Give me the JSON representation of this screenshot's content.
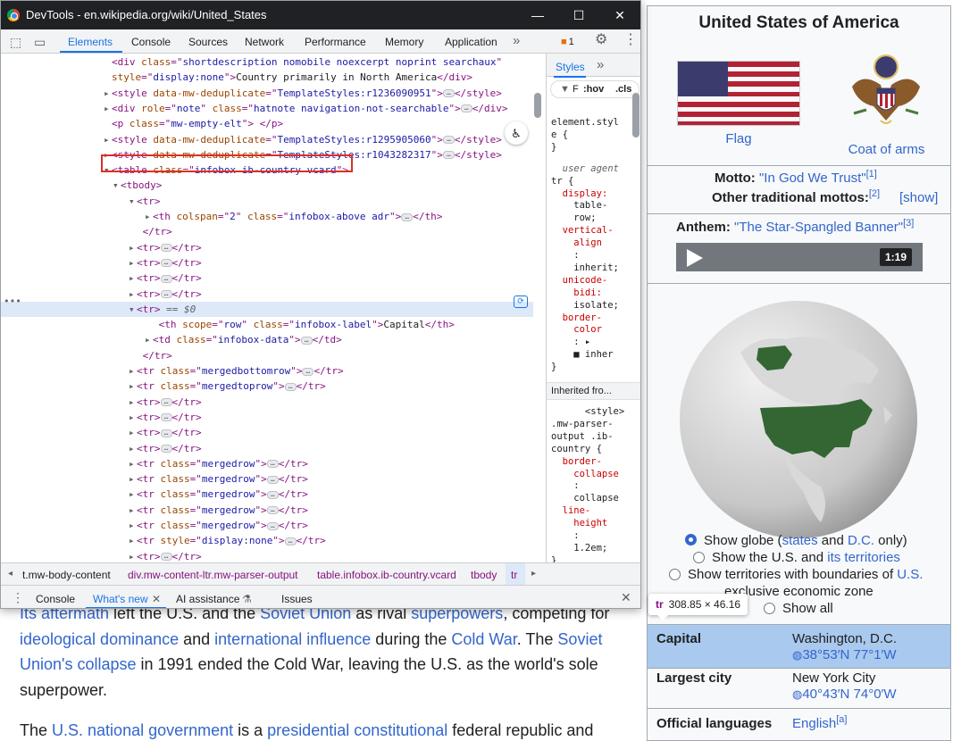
{
  "window": {
    "title": "DevTools - en.wikipedia.org/wiki/United_States",
    "minimize": "—",
    "maximize": "☐",
    "close": "✕"
  },
  "devtools_tabs": [
    "Elements",
    "Console",
    "Sources",
    "Network",
    "Performance",
    "Memory",
    "Application"
  ],
  "more_tabs": "»",
  "issues_count": "1",
  "dom_lines": [
    {
      "indent": 0,
      "tri": "",
      "parts": [
        [
          "t",
          "<div "
        ],
        [
          "n",
          "class"
        ],
        [
          "t",
          "=\""
        ],
        [
          "v",
          "shortdescription nomobile noexcerpt noprint searchaux"
        ],
        [
          "t",
          "\""
        ]
      ]
    },
    {
      "indent": 0,
      "tri": "",
      "parts": [
        [
          "n",
          "style"
        ],
        [
          "t",
          "=\""
        ],
        [
          "v",
          "display:none"
        ],
        [
          "t",
          "\">"
        ],
        [
          "x",
          "Country primarily in North America"
        ],
        [
          "t",
          "</div>"
        ]
      ]
    },
    {
      "indent": 0,
      "tri": "▸",
      "parts": [
        [
          "t",
          "<style "
        ],
        [
          "n",
          "data-mw-deduplicate"
        ],
        [
          "t",
          "=\""
        ],
        [
          "v",
          "TemplateStyles:r1236090951"
        ],
        [
          "t",
          "\">"
        ],
        [
          "p",
          "…"
        ],
        [
          "t",
          "</style>"
        ]
      ]
    },
    {
      "indent": 0,
      "tri": "▸",
      "parts": [
        [
          "t",
          "<div "
        ],
        [
          "n",
          "role"
        ],
        [
          "t",
          "=\""
        ],
        [
          "v",
          "note"
        ],
        [
          "t",
          "\" "
        ],
        [
          "n",
          "class"
        ],
        [
          "t",
          "=\""
        ],
        [
          "v",
          "hatnote navigation-not-searchable"
        ],
        [
          "t",
          "\">"
        ],
        [
          "p",
          "…"
        ],
        [
          "t",
          "</div>"
        ]
      ]
    },
    {
      "indent": 0,
      "tri": "",
      "parts": [
        [
          "t",
          "<p "
        ],
        [
          "n",
          "class"
        ],
        [
          "t",
          "=\""
        ],
        [
          "v",
          "mw-empty-elt"
        ],
        [
          "t",
          "\"> </p>"
        ]
      ]
    },
    {
      "indent": 0,
      "tri": "▸",
      "parts": [
        [
          "t",
          "<style "
        ],
        [
          "n",
          "data-mw-deduplicate"
        ],
        [
          "t",
          "=\""
        ],
        [
          "v",
          "TemplateStyles:r1295905060"
        ],
        [
          "t",
          "\">"
        ],
        [
          "p",
          "…"
        ],
        [
          "t",
          "</style>"
        ]
      ]
    },
    {
      "indent": 0,
      "tri": "▸",
      "parts": [
        [
          "t",
          "<style "
        ],
        [
          "n",
          "data-mw-deduplicate"
        ],
        [
          "t",
          "=\""
        ],
        [
          "v",
          "TemplateStyles:r1043282317"
        ],
        [
          "t",
          "\">"
        ],
        [
          "p",
          "…"
        ],
        [
          "t",
          "</style>"
        ]
      ]
    },
    {
      "indent": 0,
      "tri": "▾",
      "parts": [
        [
          "t",
          "<table "
        ],
        [
          "n",
          "class"
        ],
        [
          "t",
          "=\""
        ],
        [
          "v",
          "infobox ib-country vcard"
        ],
        [
          "t",
          "\">"
        ]
      ]
    },
    {
      "indent": 1,
      "tri": "▾",
      "parts": [
        [
          "t",
          "<tbody>"
        ]
      ]
    },
    {
      "indent": 2,
      "tri": "▾",
      "parts": [
        [
          "t",
          "<tr>"
        ]
      ]
    },
    {
      "indent": 3,
      "tri": "▸",
      "parts": [
        [
          "t",
          "<th "
        ],
        [
          "n",
          "colspan"
        ],
        [
          "t",
          "=\""
        ],
        [
          "v",
          "2"
        ],
        [
          "t",
          "\" "
        ],
        [
          "n",
          "class"
        ],
        [
          "t",
          "=\""
        ],
        [
          "v",
          "infobox-above adr"
        ],
        [
          "t",
          "\">"
        ],
        [
          "p",
          "…"
        ],
        [
          "t",
          "</th>"
        ]
      ]
    },
    {
      "indent": 2,
      "tri": "",
      "parts": [
        [
          "t",
          " </tr>"
        ]
      ]
    },
    {
      "indent": 2,
      "tri": "▸",
      "parts": [
        [
          "t",
          "<tr>"
        ],
        [
          "p",
          "…"
        ],
        [
          "t",
          "</tr>"
        ]
      ]
    },
    {
      "indent": 2,
      "tri": "▸",
      "parts": [
        [
          "t",
          "<tr>"
        ],
        [
          "p",
          "…"
        ],
        [
          "t",
          "</tr>"
        ]
      ]
    },
    {
      "indent": 2,
      "tri": "▸",
      "parts": [
        [
          "t",
          "<tr>"
        ],
        [
          "p",
          "…"
        ],
        [
          "t",
          "</tr>"
        ]
      ]
    },
    {
      "indent": 2,
      "tri": "▸",
      "parts": [
        [
          "t",
          "<tr>"
        ],
        [
          "p",
          "…"
        ],
        [
          "t",
          "</tr>"
        ]
      ]
    },
    {
      "indent": 2,
      "tri": "▾",
      "parts": [
        [
          "t",
          "<tr>"
        ],
        [
          "e",
          " == $0"
        ]
      ],
      "selected": true
    },
    {
      "indent": 3,
      "tri": "",
      "parts": [
        [
          "t",
          " <th "
        ],
        [
          "n",
          "scope"
        ],
        [
          "t",
          "=\""
        ],
        [
          "v",
          "row"
        ],
        [
          "t",
          "\" "
        ],
        [
          "n",
          "class"
        ],
        [
          "t",
          "=\""
        ],
        [
          "v",
          "infobox-label"
        ],
        [
          "t",
          "\">"
        ],
        [
          "x",
          "Capital"
        ],
        [
          "t",
          "</th>"
        ]
      ]
    },
    {
      "indent": 3,
      "tri": "▸",
      "parts": [
        [
          "t",
          "<td "
        ],
        [
          "n",
          "class"
        ],
        [
          "t",
          "=\""
        ],
        [
          "v",
          "infobox-data"
        ],
        [
          "t",
          "\">"
        ],
        [
          "p",
          "…"
        ],
        [
          "t",
          "</td>"
        ]
      ]
    },
    {
      "indent": 2,
      "tri": "",
      "parts": [
        [
          "t",
          " </tr>"
        ]
      ]
    },
    {
      "indent": 2,
      "tri": "▸",
      "parts": [
        [
          "t",
          "<tr "
        ],
        [
          "n",
          "class"
        ],
        [
          "t",
          "=\""
        ],
        [
          "v",
          "mergedbottomrow"
        ],
        [
          "t",
          "\">"
        ],
        [
          "p",
          "…"
        ],
        [
          "t",
          "</tr>"
        ]
      ]
    },
    {
      "indent": 2,
      "tri": "▸",
      "parts": [
        [
          "t",
          "<tr "
        ],
        [
          "n",
          "class"
        ],
        [
          "t",
          "=\""
        ],
        [
          "v",
          "mergedtoprow"
        ],
        [
          "t",
          "\">"
        ],
        [
          "p",
          "…"
        ],
        [
          "t",
          "</tr>"
        ]
      ]
    },
    {
      "indent": 2,
      "tri": "▸",
      "parts": [
        [
          "t",
          "<tr>"
        ],
        [
          "p",
          "…"
        ],
        [
          "t",
          "</tr>"
        ]
      ]
    },
    {
      "indent": 2,
      "tri": "▸",
      "parts": [
        [
          "t",
          "<tr>"
        ],
        [
          "p",
          "…"
        ],
        [
          "t",
          "</tr>"
        ]
      ]
    },
    {
      "indent": 2,
      "tri": "▸",
      "parts": [
        [
          "t",
          "<tr>"
        ],
        [
          "p",
          "…"
        ],
        [
          "t",
          "</tr>"
        ]
      ]
    },
    {
      "indent": 2,
      "tri": "▸",
      "parts": [
        [
          "t",
          "<tr>"
        ],
        [
          "p",
          "…"
        ],
        [
          "t",
          "</tr>"
        ]
      ]
    },
    {
      "indent": 2,
      "tri": "▸",
      "parts": [
        [
          "t",
          "<tr "
        ],
        [
          "n",
          "class"
        ],
        [
          "t",
          "=\""
        ],
        [
          "v",
          "mergedrow"
        ],
        [
          "t",
          "\">"
        ],
        [
          "p",
          "…"
        ],
        [
          "t",
          "</tr>"
        ]
      ]
    },
    {
      "indent": 2,
      "tri": "▸",
      "parts": [
        [
          "t",
          "<tr "
        ],
        [
          "n",
          "class"
        ],
        [
          "t",
          "=\""
        ],
        [
          "v",
          "mergedrow"
        ],
        [
          "t",
          "\">"
        ],
        [
          "p",
          "…"
        ],
        [
          "t",
          "</tr>"
        ]
      ]
    },
    {
      "indent": 2,
      "tri": "▸",
      "parts": [
        [
          "t",
          "<tr "
        ],
        [
          "n",
          "class"
        ],
        [
          "t",
          "=\""
        ],
        [
          "v",
          "mergedrow"
        ],
        [
          "t",
          "\">"
        ],
        [
          "p",
          "…"
        ],
        [
          "t",
          "</tr>"
        ]
      ]
    },
    {
      "indent": 2,
      "tri": "▸",
      "parts": [
        [
          "t",
          "<tr "
        ],
        [
          "n",
          "class"
        ],
        [
          "t",
          "=\""
        ],
        [
          "v",
          "mergedrow"
        ],
        [
          "t",
          "\">"
        ],
        [
          "p",
          "…"
        ],
        [
          "t",
          "</tr>"
        ]
      ]
    },
    {
      "indent": 2,
      "tri": "▸",
      "parts": [
        [
          "t",
          "<tr "
        ],
        [
          "n",
          "class"
        ],
        [
          "t",
          "=\""
        ],
        [
          "v",
          "mergedrow"
        ],
        [
          "t",
          "\">"
        ],
        [
          "p",
          "…"
        ],
        [
          "t",
          "</tr>"
        ]
      ]
    },
    {
      "indent": 2,
      "tri": "▸",
      "parts": [
        [
          "t",
          "<tr "
        ],
        [
          "n",
          "style"
        ],
        [
          "t",
          "=\""
        ],
        [
          "v",
          "display:none"
        ],
        [
          "t",
          "\">"
        ],
        [
          "p",
          "…"
        ],
        [
          "t",
          "</tr>"
        ]
      ]
    },
    {
      "indent": 2,
      "tri": "▸",
      "parts": [
        [
          "t",
          "<tr>"
        ],
        [
          "p",
          "…"
        ],
        [
          "t",
          "</tr>"
        ]
      ]
    }
  ],
  "styles_panel": {
    "tab": "Styles",
    "filter_icon": "funnel-icon",
    "filter_text": "F",
    "hov": ":hov",
    "cls": ".cls",
    "lines": [
      {
        "t": "n",
        "s": "element.styl"
      },
      {
        "t": "n",
        "s": "e {"
      },
      {
        "t": "n",
        "s": "}"
      },
      {
        "t": "gap",
        "s": ""
      },
      {
        "t": "ua",
        "s": "  user agent"
      },
      {
        "t": "n",
        "s": "tr {"
      },
      {
        "t": "p",
        "s": "  display:"
      },
      {
        "t": "n",
        "s": "    table-"
      },
      {
        "t": "n",
        "s": "    row;"
      },
      {
        "t": "p",
        "s": "  vertical-"
      },
      {
        "t": "p",
        "s": "    align"
      },
      {
        "t": "n",
        "s": "    :"
      },
      {
        "t": "n",
        "s": "    inherit;"
      },
      {
        "t": "p",
        "s": "  unicode-"
      },
      {
        "t": "p",
        "s": "    bidi:"
      },
      {
        "t": "n",
        "s": "    isolate;"
      },
      {
        "t": "p",
        "s": "  border-"
      },
      {
        "t": "p",
        "s": "    color"
      },
      {
        "t": "n",
        "s": "    : ▸"
      },
      {
        "t": "n",
        "s": "    ■ inher"
      },
      {
        "t": "n",
        "s": "}"
      }
    ],
    "inherited_label": "Inherited fro...",
    "lines2": [
      {
        "t": "n",
        "s": "      <style>"
      },
      {
        "t": "n",
        "s": ".mw-parser-"
      },
      {
        "t": "n",
        "s": "output .ib-"
      },
      {
        "t": "n",
        "s": "country {"
      },
      {
        "t": "p",
        "s": "  border-"
      },
      {
        "t": "p",
        "s": "    collapse"
      },
      {
        "t": "n",
        "s": "    :"
      },
      {
        "t": "n",
        "s": "    collapse"
      },
      {
        "t": "p",
        "s": "  line-"
      },
      {
        "t": "p",
        "s": "    height"
      },
      {
        "t": "n",
        "s": "    :"
      },
      {
        "t": "n",
        "s": "    1.2em;"
      },
      {
        "t": "n",
        "s": "}"
      },
      {
        "t": "gap",
        "s": ""
      },
      {
        "t": "n",
        "s": "   load.php?"
      }
    ]
  },
  "breadcrumbs": [
    "t.mw-body-content",
    "div.mw-content-ltr.mw-parser-output",
    "table.infobox.ib-country.vcard",
    "tbody",
    "tr"
  ],
  "drawer": {
    "tabs": [
      "Console",
      "What's new",
      "AI assistance",
      "Issues"
    ],
    "close": "✕"
  },
  "wiki_paragraph1": [
    [
      [
        "a",
        "Its aftermath"
      ],
      [
        "t",
        " left the U.S. and the "
      ],
      [
        "a",
        "Soviet Union"
      ],
      [
        "t",
        " as rival "
      ],
      [
        "a",
        "superpowers"
      ],
      [
        "t",
        ", competing for"
      ]
    ],
    [
      [
        "a",
        "ideological dominance"
      ],
      [
        "t",
        " and "
      ],
      [
        "a",
        "international influence"
      ],
      [
        "t",
        " during the "
      ],
      [
        "a",
        "Cold War"
      ],
      [
        "t",
        ". The "
      ],
      [
        "a",
        "Soviet"
      ]
    ],
    [
      [
        "a",
        "Union's collapse"
      ],
      [
        "t",
        " in 1991 ended the Cold War, leaving the U.S. as the world's sole"
      ]
    ],
    [
      [
        "t",
        "superpower."
      ]
    ]
  ],
  "wiki_paragraph2": [
    [
      [
        "t",
        "The "
      ],
      [
        "a",
        "U.S. national government"
      ],
      [
        "t",
        " is a "
      ],
      [
        "a",
        "presidential constitutional"
      ],
      [
        "t",
        " federal republic and"
      ]
    ]
  ],
  "infobox": {
    "title": "United States of America",
    "flag_caption": "Flag",
    "coat_caption": "Coat of arms",
    "motto_label": "Motto: ",
    "motto_value": "\"In God We Trust\"",
    "motto_ref": "[1]",
    "other_mottos_label": "Other traditional mottos:",
    "other_mottos_ref": "[2]",
    "show_link": "[show]",
    "anthem_label": "Anthem: ",
    "anthem_value": "\"The Star-Spangled Banner\"",
    "anthem_ref": "[3]",
    "player_time": "1:19",
    "radio1_a": "Show globe (",
    "radio1_b": "states",
    "radio1_c": " and ",
    "radio1_d": "D.C.",
    "radio1_e": " only)",
    "radio2_a": "Show the U.S. and ",
    "radio2_b": "its territories",
    "radio3_a": "Show territories with boundaries of ",
    "radio3_b": "U.S.",
    "radio3_c": "exclusive economic zone",
    "radio4": "Show all",
    "capital_label": "Capital",
    "capital_value": "Washington, D.C.",
    "capital_coords": "38°53′N 77°1′W",
    "largest_label": "Largest city",
    "largest_value": "New York City",
    "largest_coords": "40°43′N 74°0′W",
    "languages_label": "Official languages",
    "languages_value": "English",
    "languages_ref": "[a]"
  },
  "tooltip": {
    "tag": "tr",
    "size": "308.85 × 46.16"
  },
  "colors": {
    "link": "#3366cc",
    "tag": "#881280",
    "attr_name": "#994500",
    "attr_value": "#1a1aa6",
    "highlight": "#a9c9ee",
    "annotation_box": "#d93025",
    "globe_land": "#336633"
  }
}
